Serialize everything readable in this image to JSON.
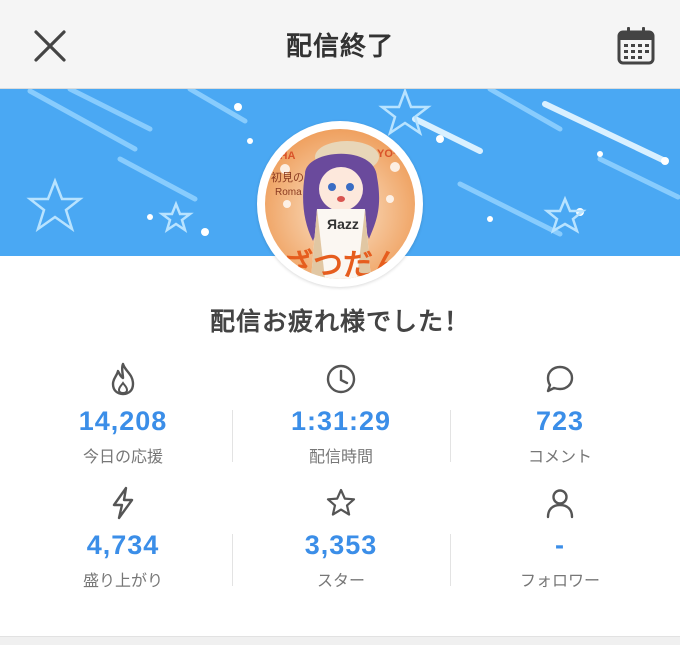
{
  "header": {
    "title": "配信終了"
  },
  "avatar": {
    "logo_text": "Яazz",
    "sub_texts": [
      "OHA",
      "YO~!!",
      "初見の",
      "Roma",
      "ざつだん"
    ]
  },
  "message": "配信お疲れ様でした！",
  "stats": [
    {
      "icon": "fire-icon",
      "value": "14,208",
      "label": "今日の応援"
    },
    {
      "icon": "clock-icon",
      "value": "1:31:29",
      "label": "配信時間"
    },
    {
      "icon": "speech-bubble-icon",
      "value": "723",
      "label": "コメント"
    },
    {
      "icon": "lightning-icon",
      "value": "4,734",
      "label": "盛り上がり"
    },
    {
      "icon": "star-icon",
      "value": "3,353",
      "label": "スター"
    },
    {
      "icon": "person-icon",
      "value": "-",
      "label": "フォロワー"
    }
  ],
  "colors": {
    "accent": "#3b8ee8",
    "banner": "#4aa8f3"
  }
}
